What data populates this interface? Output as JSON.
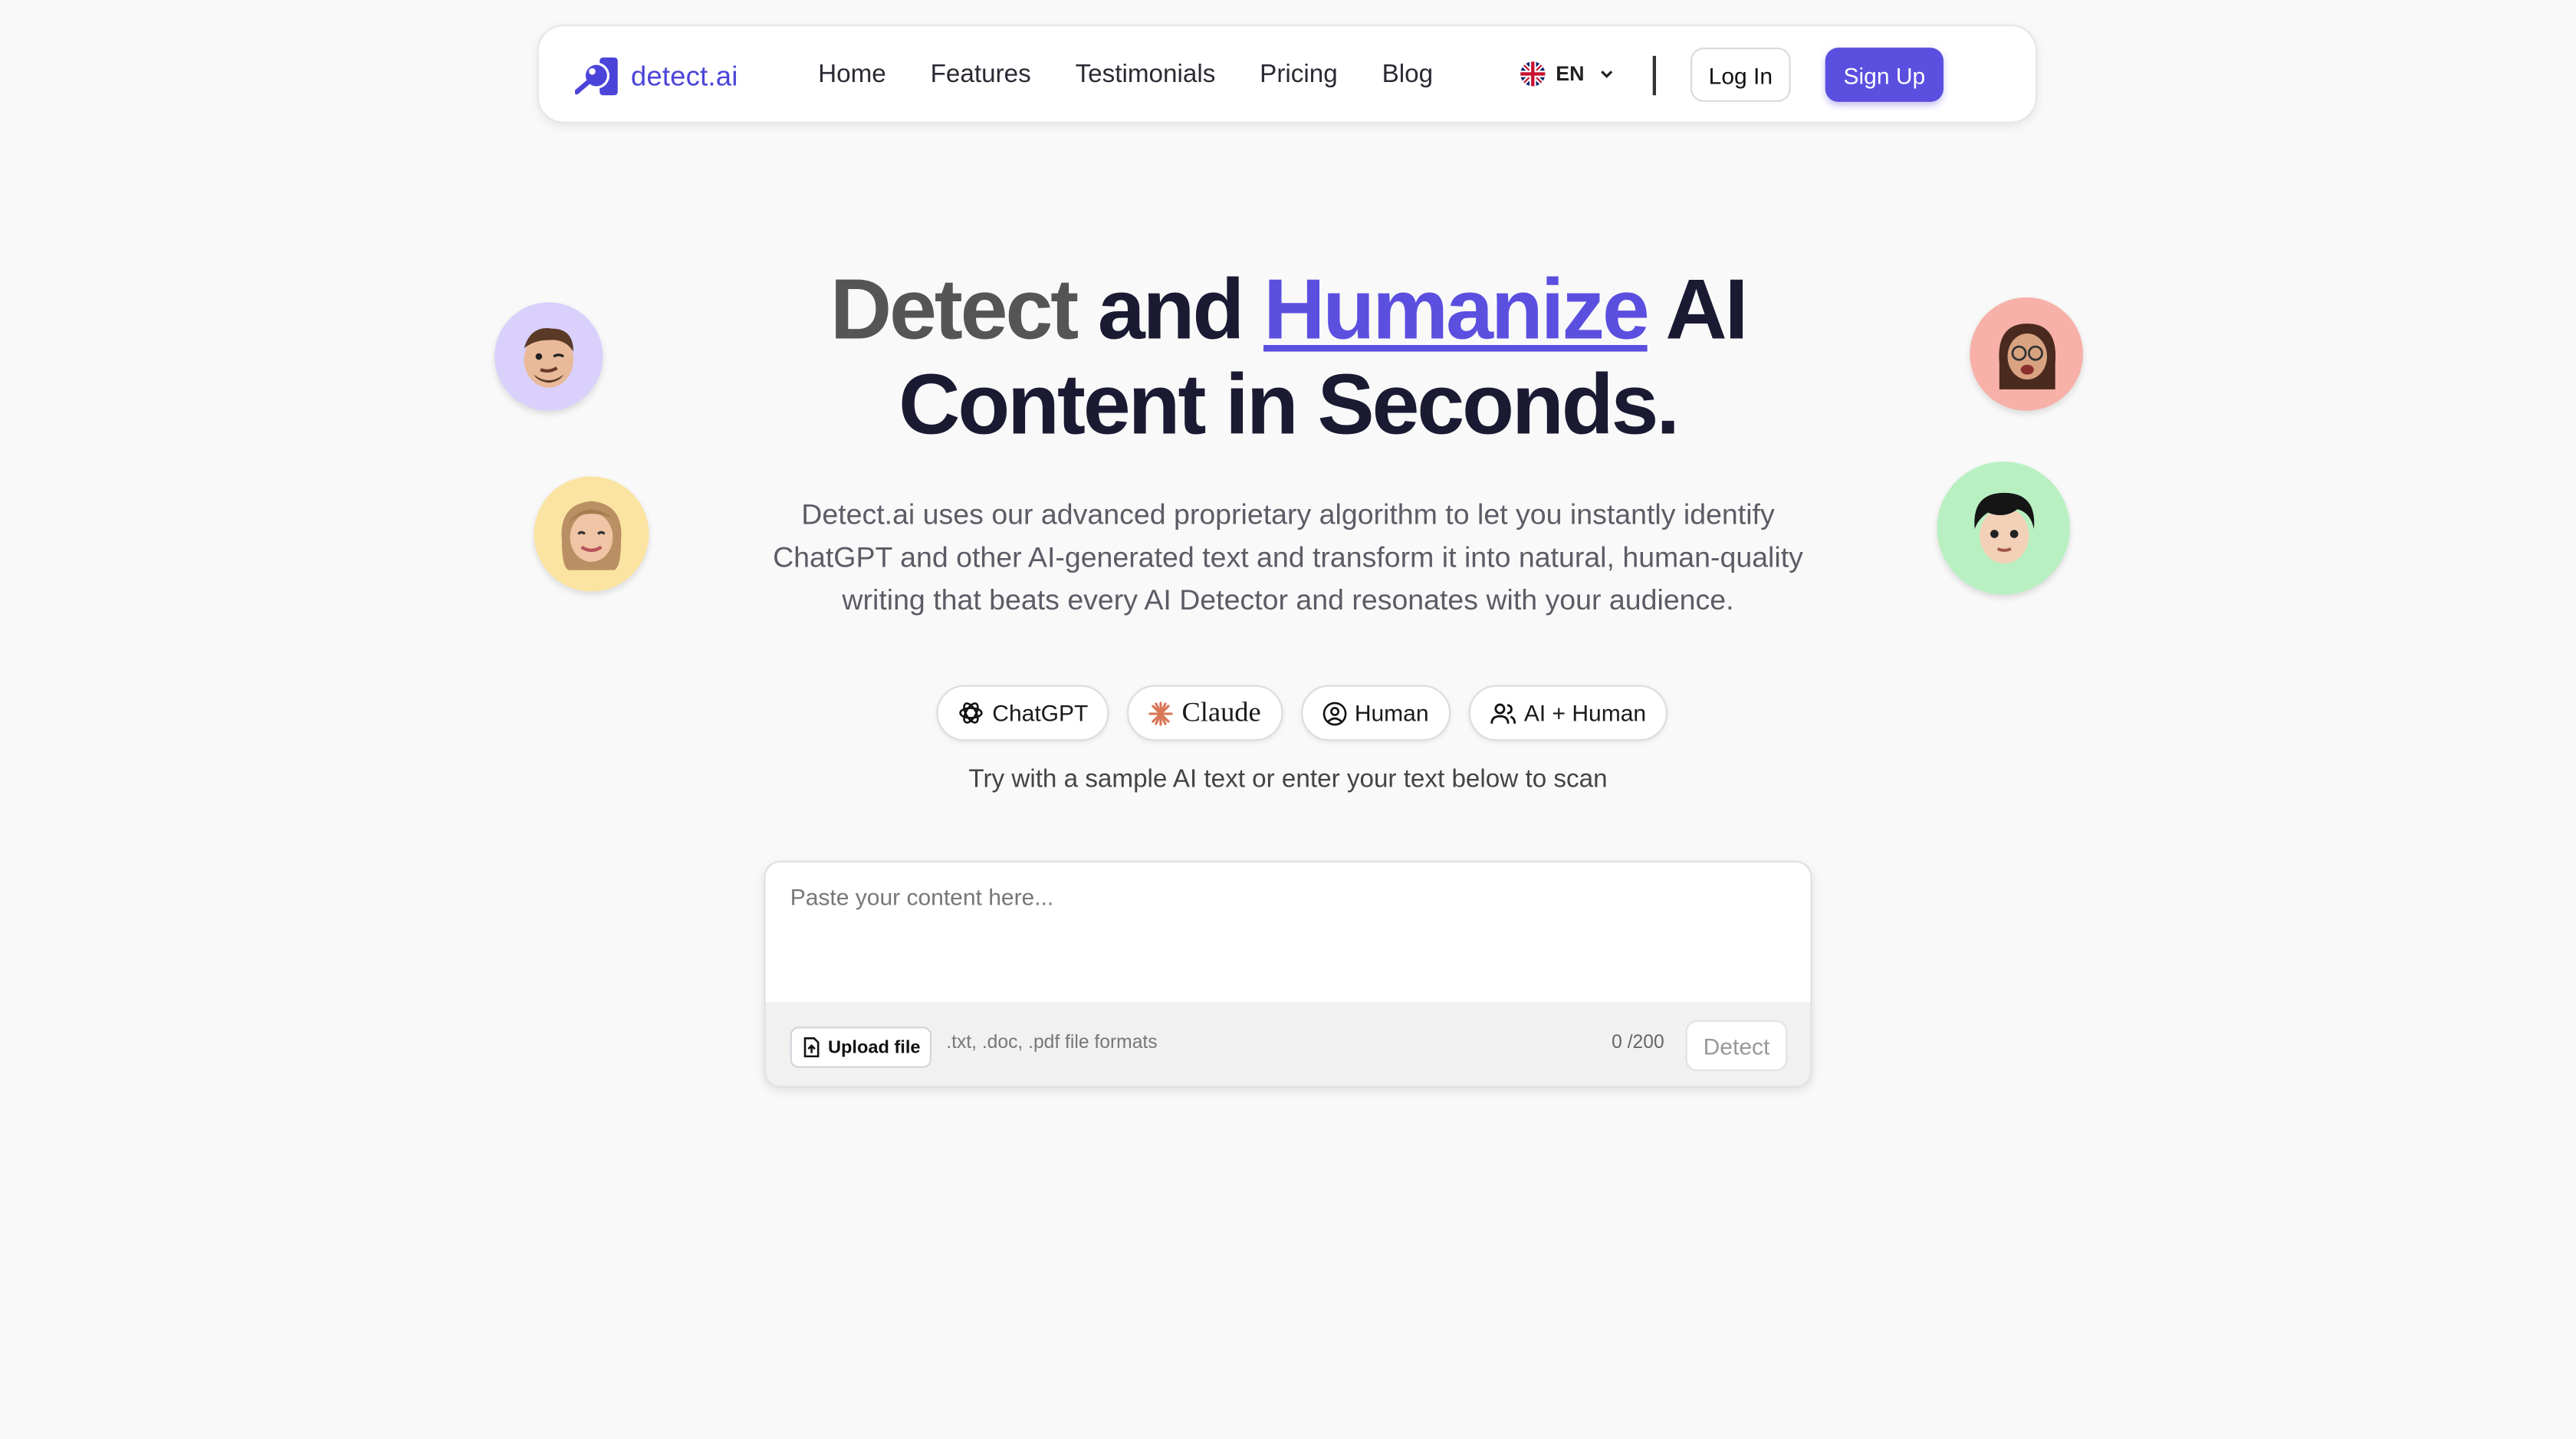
{
  "nav": {
    "brand": "detect.ai",
    "links": [
      "Home",
      "Features",
      "Testimonials",
      "Pricing",
      "Blog"
    ],
    "language": "EN",
    "login_label": "Log In",
    "signup_label": "Sign Up"
  },
  "hero": {
    "title_part1": "Detect",
    "title_part2": "and",
    "title_accent": "Humanize",
    "title_part3": "AI",
    "title_line2": "Content in Seconds.",
    "subtitle": "Detect.ai uses our advanced proprietary algorithm to let you instantly identify ChatGPT and other AI-generated text and transform it into natural, human-quality writing that beats every AI Detector and resonates with your audience."
  },
  "samples": {
    "chips": [
      "ChatGPT",
      "Claude",
      "Human",
      "AI + Human"
    ],
    "hint": "Try with a sample AI text or enter your text below to scan"
  },
  "editor": {
    "placeholder": "Paste your content here...",
    "upload_label": "Upload file",
    "formats": ".txt, .doc, .pdf file formats",
    "counter": "0 /200",
    "detect_label": "Detect"
  },
  "colors": {
    "accent": "#5b4fe0",
    "background": "#f9f9f9"
  }
}
